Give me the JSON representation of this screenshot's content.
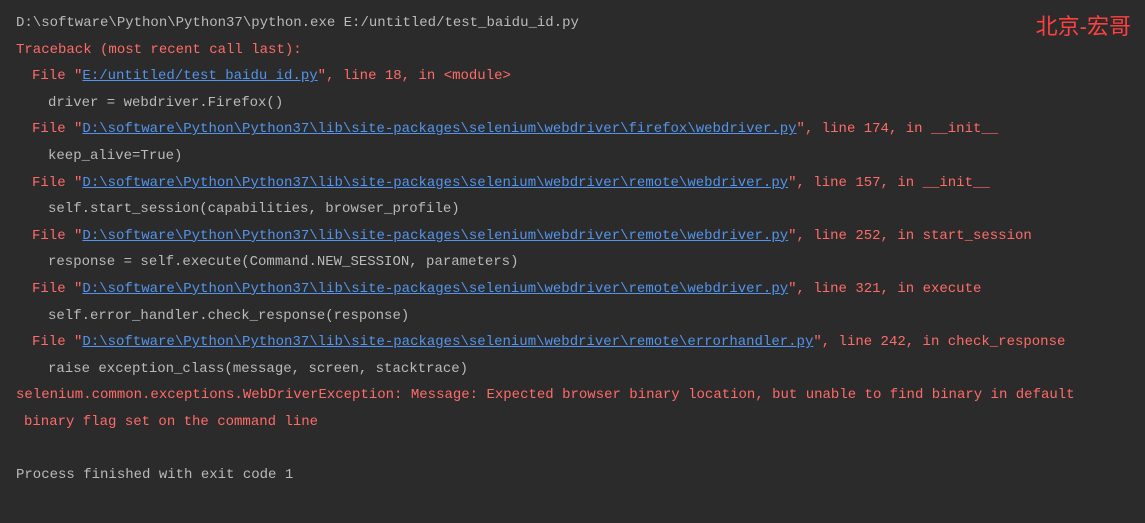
{
  "watermark": "北京-宏哥",
  "cmd": "D:\\software\\Python\\Python37\\python.exe E:/untitled/test_baidu_id.py",
  "traceback_header": "Traceback (most recent call last):",
  "frames": [
    {
      "prefix": "  File \"",
      "link": "E:/untitled/test_baidu_id.py",
      "suffix": "\", line 18, in <module>",
      "code": "    driver = webdriver.Firefox()"
    },
    {
      "prefix": "  File \"",
      "link": "D:\\software\\Python\\Python37\\lib\\site-packages\\selenium\\webdriver\\firefox\\webdriver.py",
      "suffix": "\", line 174, in __init__",
      "code": "    keep_alive=True)"
    },
    {
      "prefix": "  File \"",
      "link": "D:\\software\\Python\\Python37\\lib\\site-packages\\selenium\\webdriver\\remote\\webdriver.py",
      "suffix": "\", line 157, in __init__",
      "code": "    self.start_session(capabilities, browser_profile)"
    },
    {
      "prefix": "  File \"",
      "link": "D:\\software\\Python\\Python37\\lib\\site-packages\\selenium\\webdriver\\remote\\webdriver.py",
      "suffix": "\", line 252, in start_session",
      "code": "    response = self.execute(Command.NEW_SESSION, parameters)"
    },
    {
      "prefix": "  File \"",
      "link": "D:\\software\\Python\\Python37\\lib\\site-packages\\selenium\\webdriver\\remote\\webdriver.py",
      "suffix": "\", line 321, in execute",
      "code": "    self.error_handler.check_response(response)"
    },
    {
      "prefix": "  File \"",
      "link": "D:\\software\\Python\\Python37\\lib\\site-packages\\selenium\\webdriver\\remote\\errorhandler.py",
      "suffix": "\", line 242, in check_response",
      "code": "    raise exception_class(message, screen, stacktrace)"
    }
  ],
  "error_line1": "selenium.common.exceptions.WebDriverException: Message: Expected browser binary location, but unable to find binary in default",
  "error_line2": " binary flag set on the command line",
  "exit": "Process finished with exit code 1"
}
